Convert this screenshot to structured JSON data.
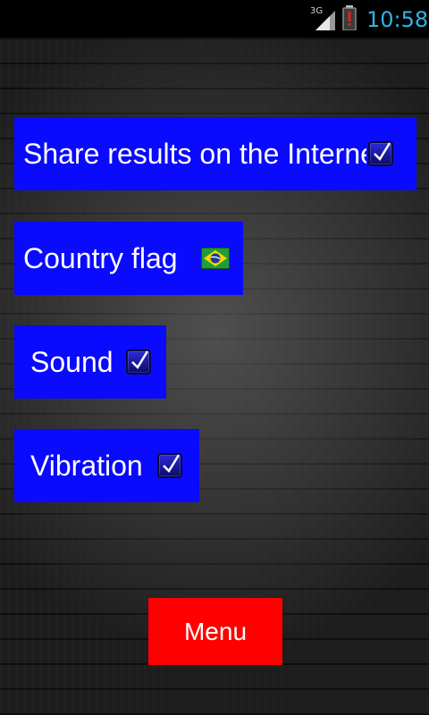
{
  "status_bar": {
    "network_type": "3G",
    "time": "10:58",
    "colors": {
      "time": "#2fb3e6",
      "battery_alert": "#e02020"
    },
    "icons": [
      "signal-icon",
      "battery-alert-icon"
    ]
  },
  "options": {
    "share": {
      "label": "Share results on the Internet",
      "checked": true
    },
    "country_flag": {
      "label": "Country flag",
      "flag_icon": "brazil-flag-icon"
    },
    "sound": {
      "label": "Sound",
      "checked": true
    },
    "vibration": {
      "label": "Vibration",
      "checked": true
    }
  },
  "menu_button": {
    "label": "Menu"
  },
  "colors": {
    "option_button": "#0a0aff",
    "menu_button": "#ff0000"
  }
}
